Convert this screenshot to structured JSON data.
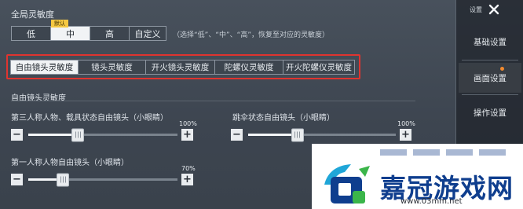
{
  "global": {
    "title": "全局灵敏度",
    "presets": [
      "低",
      "中",
      "高",
      "自定义"
    ],
    "active_preset_index": 1,
    "default_tag": "默认",
    "hint": "（选择“低”、“中”、“高”，恢复至对应的灵敏度）"
  },
  "tabs": {
    "items": [
      "自由镜头灵敏度",
      "镜头灵敏度",
      "开火镜头灵敏度",
      "陀螺仪灵敏度",
      "开火陀螺仪灵敏度"
    ],
    "active_index": 0,
    "highlight_color": "#e0342f"
  },
  "section": {
    "title": "自由镜头灵敏度"
  },
  "sliders": [
    {
      "label": "第三人称人物、载具状态自由镜头（小眼睛）",
      "value_label": "100%",
      "value": 100,
      "max": 300,
      "minus": "−",
      "plus": "+"
    },
    {
      "label": "跳伞状态自由镜头（小眼睛）",
      "value_label": "100%",
      "value": 100,
      "max": 300,
      "minus": "−",
      "plus": "+"
    },
    {
      "label": "第一人称人物自由镜头（小眼睛）",
      "value_label": "70%",
      "value": 70,
      "max": 300,
      "minus": "−",
      "plus": "+"
    }
  ],
  "side": {
    "header": "设置",
    "close_icon": "close-icon",
    "items": [
      "基础设置",
      "画面设置",
      "操作设置"
    ],
    "notify_color": "#f28a2e"
  },
  "watermark": {
    "name": "嘉冠游戏网",
    "url": "www.03mm.net",
    "colors": {
      "primary": "#0f3e8e",
      "green": "#3bb54a",
      "cyan": "#1fa6d8"
    }
  }
}
